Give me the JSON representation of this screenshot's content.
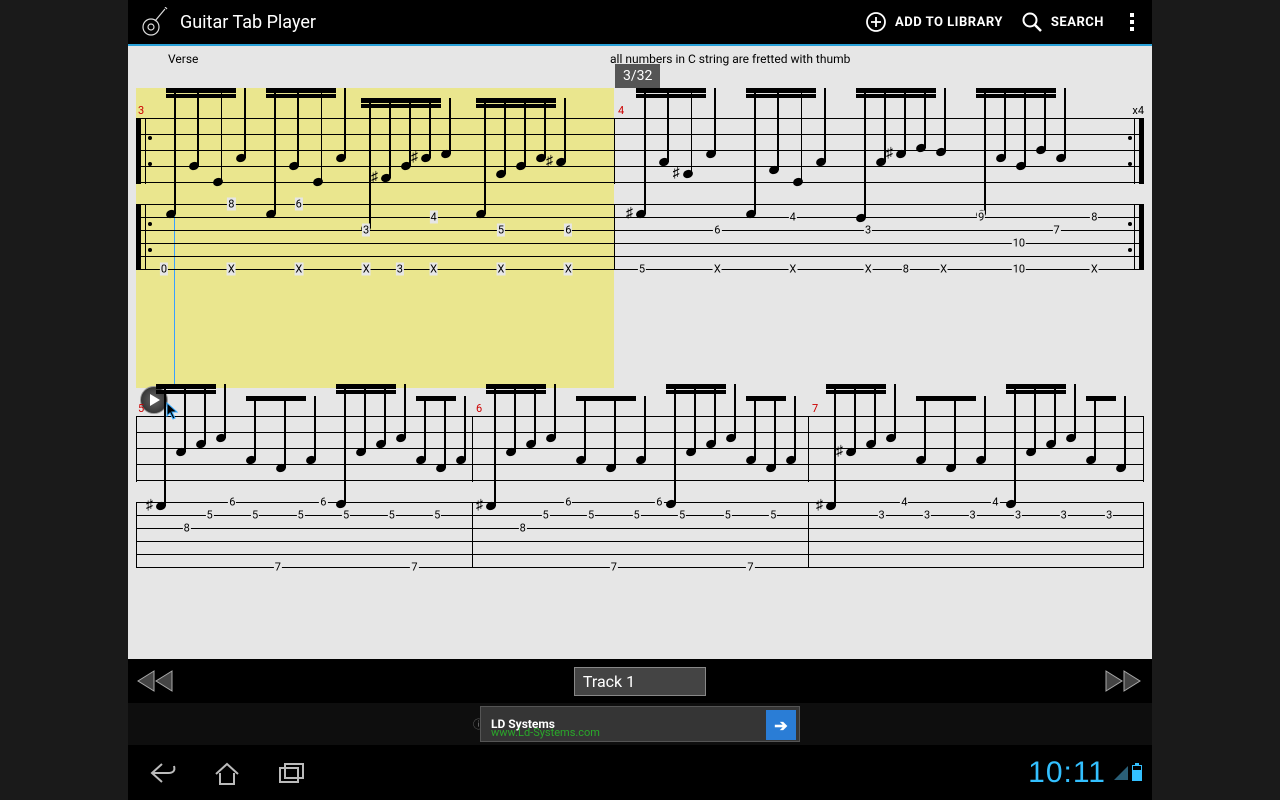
{
  "app": {
    "title": "Guitar Tab Player",
    "add_label": "ADD TO LIBRARY",
    "search_label": "SEARCH"
  },
  "sheet": {
    "section": "Verse",
    "thumb_note": "all numbers in C string are fretted with thumb",
    "counter": "3/32",
    "repeat_x4": "x4",
    "measures": {
      "m3": {
        "num": "3",
        "tab_rows": [
          [
            "",
            "",
            "8",
            "",
            "6",
            "",
            "",
            "",
            "",
            "",
            "",
            "",
            "",
            ""
          ],
          [
            "",
            "",
            "",
            "",
            "",
            "",
            "",
            "",
            "4",
            "",
            "",
            "",
            "",
            ""
          ],
          [
            "",
            "",
            "",
            "",
            "",
            "",
            "3",
            "",
            "",
            "",
            "5",
            "",
            "6",
            ""
          ],
          [
            "",
            "",
            "",
            "",
            "",
            "",
            "",
            "",
            "",
            "",
            "",
            "",
            "",
            ""
          ],
          [
            "",
            "",
            "",
            "",
            "",
            "",
            "",
            "",
            "",
            "",
            "",
            "",
            "",
            ""
          ],
          [
            "0",
            "",
            "X",
            "",
            "X",
            "",
            "X",
            "3",
            "X",
            "",
            "X",
            "",
            "X",
            ""
          ]
        ]
      },
      "m4": {
        "num": "4",
        "tab_rows": [
          [
            "",
            "",
            "",
            "",
            "",
            "",
            "",
            "",
            "",
            "",
            "",
            "",
            "",
            ""
          ],
          [
            "",
            "",
            "",
            "",
            "4",
            "",
            "",
            "",
            "",
            "9",
            "",
            "",
            "8",
            ""
          ],
          [
            "",
            "",
            "6",
            "",
            "",
            "",
            "3",
            "",
            "",
            "",
            "",
            "7",
            "",
            ""
          ],
          [
            "",
            "",
            "",
            "",
            "",
            "",
            "",
            "",
            "",
            "",
            "10",
            "",
            "",
            ""
          ],
          [
            "",
            "",
            "",
            "",
            "",
            "",
            "",
            "",
            "",
            "",
            "",
            "",
            "",
            ""
          ],
          [
            "5",
            "",
            "X",
            "",
            "X",
            "",
            "X",
            "8",
            "X",
            "",
            "10",
            "",
            "X",
            ""
          ]
        ]
      },
      "m5": {
        "num": "5",
        "tab_rows": [
          [
            "",
            "",
            "",
            "6",
            "",
            "",
            "",
            "6",
            "",
            "",
            "",
            "",
            "",
            ""
          ],
          [
            "",
            "",
            "5",
            "",
            "5",
            "",
            "5",
            "",
            "5",
            "",
            "5",
            "",
            "5",
            ""
          ],
          [
            "",
            "8",
            "",
            "",
            "",
            "",
            "",
            "",
            "",
            "",
            "",
            "",
            "",
            ""
          ],
          [
            "",
            "",
            "",
            "",
            "",
            "",
            "",
            "",
            "",
            "",
            "",
            "",
            "",
            ""
          ],
          [
            "",
            "",
            "",
            "",
            "",
            "",
            "",
            "",
            "",
            "",
            "",
            "",
            "",
            ""
          ],
          [
            "",
            "",
            "",
            "",
            "",
            "7",
            "",
            "",
            "",
            "",
            "",
            "7",
            "",
            ""
          ]
        ]
      },
      "m6": {
        "num": "6",
        "tab_rows": [
          [
            "",
            "",
            "",
            "6",
            "",
            "",
            "",
            "6",
            "",
            "",
            "",
            "",
            "",
            ""
          ],
          [
            "",
            "",
            "5",
            "",
            "5",
            "",
            "5",
            "",
            "5",
            "",
            "5",
            "",
            "5",
            ""
          ],
          [
            "",
            "8",
            "",
            "",
            "",
            "",
            "",
            "",
            "",
            "",
            "",
            "",
            "",
            ""
          ],
          [
            "",
            "",
            "",
            "",
            "",
            "",
            "",
            "",
            "",
            "",
            "",
            "",
            "",
            ""
          ],
          [
            "",
            "",
            "",
            "",
            "",
            "",
            "",
            "",
            "",
            "",
            "",
            "",
            "",
            ""
          ],
          [
            "",
            "",
            "",
            "",
            "",
            "7",
            "",
            "",
            "",
            "",
            "",
            "7",
            "",
            ""
          ]
        ]
      },
      "m7": {
        "num": "7",
        "tab_rows": [
          [
            "",
            "",
            "",
            "4",
            "",
            "",
            "",
            "4",
            "",
            "",
            "",
            "",
            "",
            ""
          ],
          [
            "",
            "",
            "3",
            "",
            "3",
            "",
            "3",
            "",
            "3",
            "",
            "3",
            "",
            "3",
            ""
          ],
          [
            "",
            "",
            "",
            "",
            "",
            "",
            "",
            "",
            "",
            "",
            "",
            "",
            "",
            ""
          ],
          [
            "",
            "",
            "",
            "",
            "",
            "",
            "",
            "",
            "",
            "",
            "",
            "",
            "",
            ""
          ],
          [
            "",
            "",
            "",
            "",
            "",
            "",
            "",
            "",
            "",
            "",
            "",
            "",
            "",
            ""
          ],
          [
            "",
            "",
            "",
            "",
            "",
            "",
            "",
            "",
            "",
            "",
            "",
            "",
            "",
            ""
          ]
        ]
      }
    }
  },
  "controls": {
    "track_label": "Track 1"
  },
  "ad": {
    "title": "LD Systems",
    "url": "www.Ld-Systems.com",
    "arrow": "➔"
  },
  "status": {
    "time": "10:11"
  }
}
